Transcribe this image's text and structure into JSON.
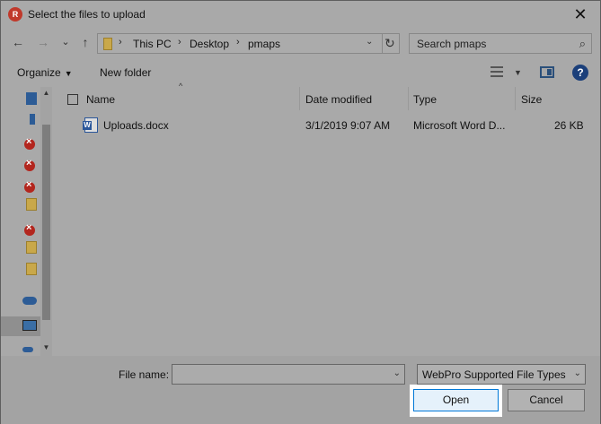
{
  "window": {
    "title": "Select the files to upload",
    "app_icon": "webpro-logo-icon",
    "close_glyph": "✕"
  },
  "nav": {
    "back": "←",
    "forward": "→",
    "recent": "⌄",
    "up": "↑",
    "breadcrumbs": [
      "This PC",
      "Desktop",
      "pmaps"
    ],
    "separator": "›",
    "address_dropdown": "⌄",
    "refresh": "↻"
  },
  "search": {
    "placeholder": "Search pmaps",
    "icon": "⌕"
  },
  "toolbar": {
    "organize": "Organize",
    "organize_caret": "▼",
    "new_folder": "New folder",
    "view_caret": "▼",
    "help": "?"
  },
  "navpane": {
    "scroll_up": "▲",
    "scroll_down": "▼"
  },
  "columns": {
    "sort_caret": "^",
    "name": "Name",
    "date_modified": "Date modified",
    "type": "Type",
    "size": "Size"
  },
  "files": [
    {
      "name": "Uploads.docx",
      "date_modified": "3/1/2019 9:07 AM",
      "type": "Microsoft Word D...",
      "size": "26 KB",
      "icon": "word-doc-icon"
    }
  ],
  "footer": {
    "file_name_label": "File name:",
    "file_name_value": "",
    "file_name_caret": "⌄",
    "file_type_selected": "WebPro Supported File Types",
    "file_type_caret": "⌄",
    "open_label": "Open",
    "cancel_label": "Cancel"
  },
  "colors": {
    "accent": "#0078d7",
    "overlay": "#a9a9a9",
    "open_highlight": "#ffffff"
  }
}
